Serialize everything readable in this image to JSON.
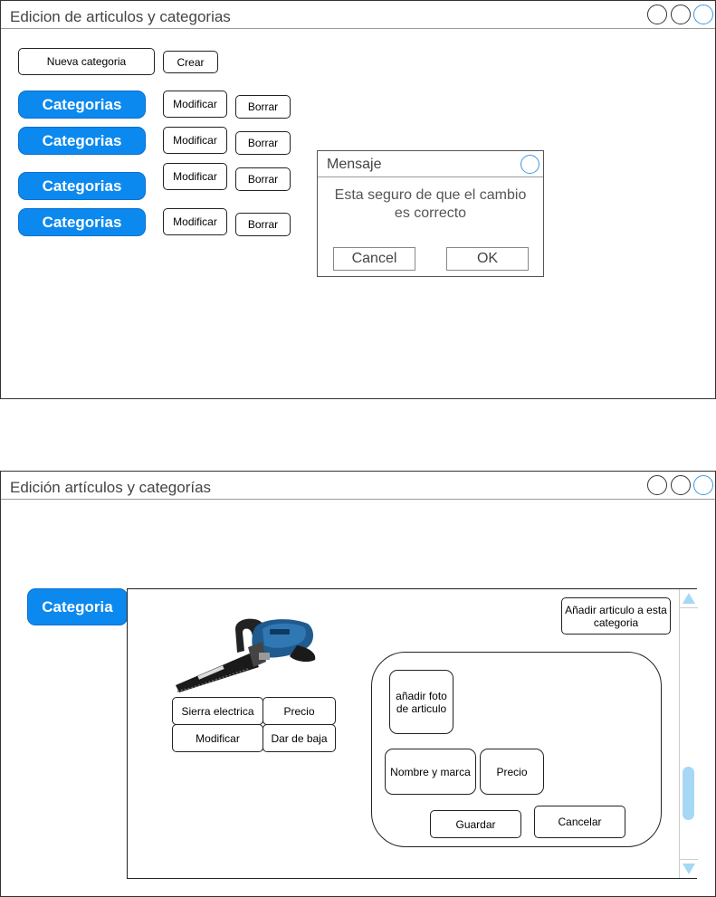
{
  "screen1": {
    "title": "Edicion de articulos y categorias",
    "new_category_input": "Nueva categoria",
    "create_button": "Crear",
    "categories": [
      {
        "label": "Categorias",
        "modify": "Modificar",
        "delete": "Borrar"
      },
      {
        "label": "Categorias",
        "modify": "Modificar",
        "delete": "Borrar"
      },
      {
        "label": "Categorias",
        "modify": "Modificar",
        "delete": "Borrar"
      },
      {
        "label": "Categorias",
        "modify": "Modificar",
        "delete": "Borrar"
      }
    ],
    "dialog": {
      "title": "Mensaje",
      "message_line1": "Esta seguro de que el cambio",
      "message_line2": "es correcto",
      "cancel": "Cancel",
      "ok": "OK"
    }
  },
  "screen2": {
    "title": "Edición artículos y categorías",
    "category_tab": "Categoria",
    "add_article_line1": "Añadir articulo a esta",
    "add_article_line2": "categoria",
    "product": {
      "name": "Sierra electrica",
      "price": "Precio",
      "modify": "Modificar",
      "remove": "Dar de baja"
    },
    "form": {
      "add_photo_line1": "añadir foto",
      "add_photo_line2": "de articulo",
      "name_brand": "Nombre y marca",
      "price": "Precio",
      "save": "Guardar",
      "cancel": "Cancelar"
    }
  },
  "colors": {
    "accent_blue": "#0c89ee",
    "scroll_blue": "#a6d8f6",
    "window_control_active": "#3a9ae5"
  },
  "icons": [
    "close-circle-icon",
    "minimize-circle-icon",
    "maximize-circle-icon",
    "scroll-up-arrow-icon",
    "scroll-down-arrow-icon"
  ]
}
